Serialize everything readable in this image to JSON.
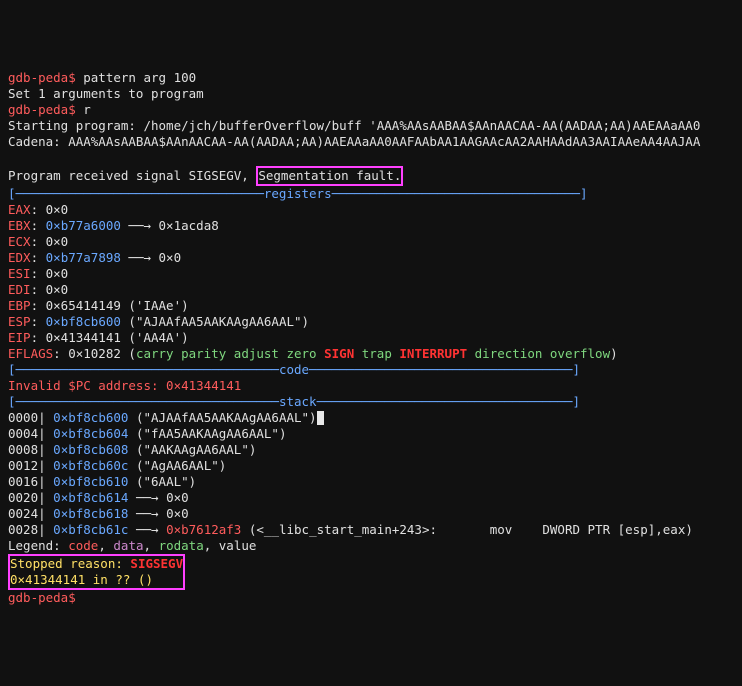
{
  "prompt": "gdb-peda$",
  "cmd1": " pattern arg 100",
  "line_set": "Set 1 arguments to program",
  "cmd2": " r",
  "start_prog": "Starting program: /home/jch/bufferOverflow/buff 'AAA%AAsAABAA$AAnAACAA-AA(AADAA;AA)AAEAAaAA0",
  "cadena": "Cadena: AAA%AAsAABAA$AAnAACAA-AA(AADAA;AA)AAEAAaAA0AAFAAbAA1AAGAAcAA2AAHAAdAA3AAIAAeAA4AAJAA",
  "sig_line_pre": "Program received signal SIGSEGV, ",
  "sig_highlight": "Segmentation fault.",
  "hdr_reg_pre": "[─────────────────────────────────",
  "hdr_reg_lbl": "registers",
  "hdr_reg_post": "─────────────────────────────────]",
  "eax_k": "EAX",
  "eax_v": ": 0×0",
  "ebx_k": "EBX",
  "ebx_a": "0×b77a6000",
  "ebx_t": " ──→ 0×1acda8",
  "ecx_k": "ECX",
  "ecx_v": ": 0×0",
  "edx_k": "EDX",
  "edx_a": "0×b77a7898",
  "edx_t": " ──→ 0×0",
  "esi_k": "ESI",
  "esi_v": ": 0×0",
  "edi_k": "EDI",
  "edi_v": ": 0×0",
  "ebp_k": "EBP",
  "ebp_v": ": 0×65414149 ('IAAe')",
  "esp_k": "ESP",
  "esp_a": "0×bf8cb600",
  "esp_t": " (\"AJAAfAA5AAKAAgAA6AAL\")",
  "eip_k": "EIP",
  "eip_v": ": 0×41344141 ('AA4A')",
  "eflags_k": "EFLAGS",
  "eflags_v": ": 0×10282 (",
  "ef_carry": "carry ",
  "ef_parity": "parity ",
  "ef_adjust": "adjust ",
  "ef_zero": "zero ",
  "ef_sign": "SIGN",
  "ef_trap": " trap ",
  "ef_int": "INTERRUPT",
  "ef_dir": " direction overflow",
  "ef_close": ")",
  "hdr_code_pre": "[───────────────────────────────────",
  "hdr_code_lbl": "code",
  "hdr_code_post": "───────────────────────────────────]",
  "invalid_pc": "Invalid $PC address: 0×41344141",
  "hdr_stack_pre": "[───────────────────────────────────",
  "hdr_stack_lbl": "stack",
  "hdr_stack_post": "──────────────────────────────────]",
  "s0_off": "0000",
  "s0_addr": "0×bf8cb600",
  "s0_tail": " (\"AJAAfAA5AAKAAgAA6AAL\")",
  "s1_off": "0004",
  "s1_addr": "0×bf8cb604",
  "s1_tail": " (\"fAA5AAKAAgAA6AAL\")",
  "s2_off": "0008",
  "s2_addr": "0×bf8cb608",
  "s2_tail": " (\"AAKAAgAA6AAL\")",
  "s3_off": "0012",
  "s3_addr": "0×bf8cb60c",
  "s3_tail": " (\"AgAA6AAL\")",
  "s4_off": "0016",
  "s4_addr": "0×bf8cb610",
  "s4_tail": " (\"6AAL\")",
  "s5_off": "0020",
  "s5_addr": "0×bf8cb614",
  "s5_tail": " ──→ 0×0",
  "s6_off": "0024",
  "s6_addr": "0×bf8cb618",
  "s6_tail": " ──→ 0×0",
  "s7_off": "0028",
  "s7_addr": "0×bf8cb61c",
  "s7_arr": " ──→ ",
  "s7_addr2": "0×b7612af3",
  "s7_tail": " (<__libc_start_main+243>:       mov    DWORD PTR [esp],eax)",
  "legend_pre": "Legend: ",
  "legend_code": "code",
  "legend_sep1": ", ",
  "legend_data": "data",
  "legend_sep2": ", ",
  "legend_rodata": "rodata",
  "legend_sep3": ", value",
  "stopped": "Stopped reason: ",
  "sigsegv": "SIGSEGV",
  "crash_addr": "0×41344141 in ?? ()"
}
